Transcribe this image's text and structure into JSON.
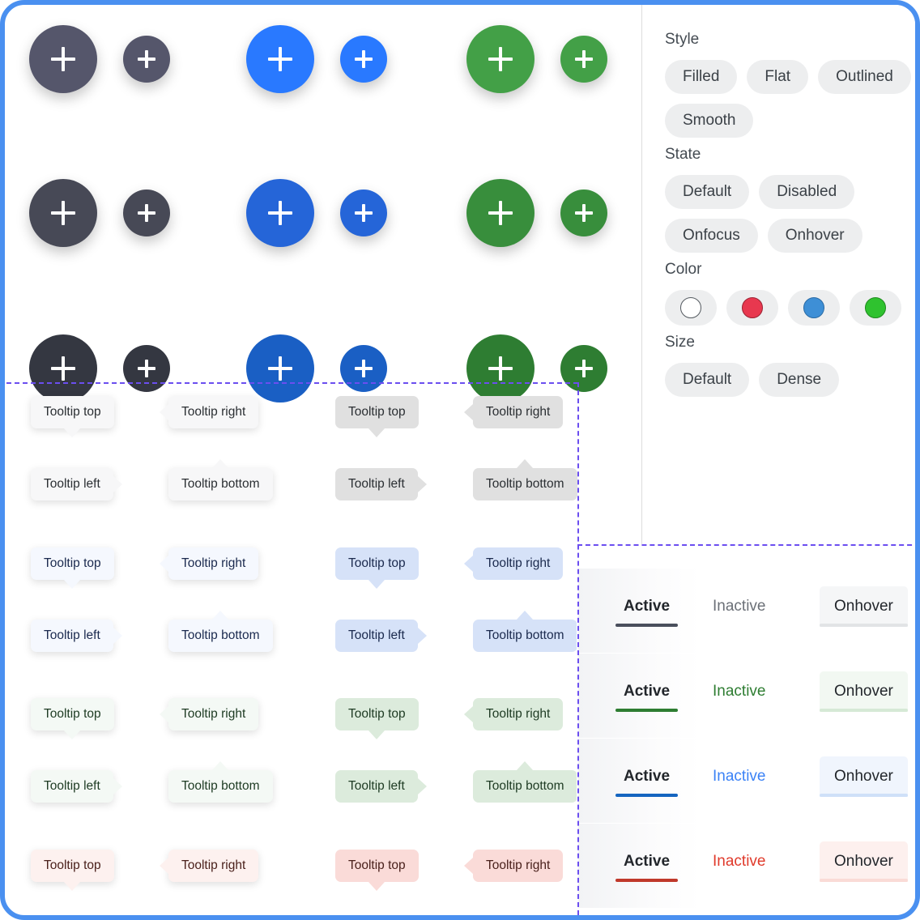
{
  "frame": {
    "border_color": "#4a90f0",
    "corner_radius": "30px",
    "guide_color": "#6b4ef0",
    "divider_color": "#dddddd"
  },
  "fab_section": {
    "name": "floating-action-buttons",
    "icon": "plus-icon",
    "rows": [
      {
        "style": "filled-shadow",
        "shadow": true,
        "groups": [
          {
            "color": "#55566b",
            "label": "dark"
          },
          {
            "color": "#2979ff",
            "label": "blue"
          },
          {
            "color": "#43a047",
            "label": "green"
          }
        ]
      },
      {
        "style": "filled-shadow",
        "shadow": true,
        "groups": [
          {
            "color": "#474956",
            "label": "dark"
          },
          {
            "color": "#2565d8",
            "label": "blue"
          },
          {
            "color": "#388e3c",
            "label": "green"
          }
        ]
      },
      {
        "style": "flat",
        "shadow": false,
        "groups": [
          {
            "color": "#343741",
            "label": "dark"
          },
          {
            "color": "#1a5fc4",
            "label": "blue"
          },
          {
            "color": "#2e7d32",
            "label": "green"
          }
        ]
      }
    ],
    "sizes": [
      "default",
      "dense"
    ]
  },
  "tooltips": {
    "name": "tooltip-gallery",
    "labels": {
      "top": "Tooltip top",
      "right": "Tooltip right",
      "left": "Tooltip left",
      "bottom": "Tooltip bottom"
    },
    "variants": [
      {
        "color_name": "neutral",
        "filled": {
          "bg": "#f7f7f8",
          "fg": "#2b2f33",
          "shadow": true
        },
        "flat": {
          "bg": "#e0e0e0",
          "fg": "#2b2f33",
          "shadow": false
        }
      },
      {
        "color_name": "blue",
        "filled": {
          "bg": "#f5f8fe",
          "fg": "#1b2a4e",
          "shadow": true
        },
        "flat": {
          "bg": "#d6e2f8",
          "fg": "#1b2a4e",
          "shadow": false
        }
      },
      {
        "color_name": "green",
        "filled": {
          "bg": "#f4f9f5",
          "fg": "#1e3b23",
          "shadow": true
        },
        "flat": {
          "bg": "#dcebdc",
          "fg": "#1e3b23",
          "shadow": false
        }
      },
      {
        "color_name": "red",
        "filled": {
          "bg": "#fdf1ef",
          "fg": "#4a211c",
          "shadow": true
        },
        "flat": {
          "bg": "#fadbd8",
          "fg": "#4a211c",
          "shadow": false
        }
      }
    ]
  },
  "sidebar": {
    "name": "properties-panel",
    "sections": [
      {
        "label": "Style",
        "key": "style",
        "options": [
          "Filled",
          "Flat",
          "Outlined",
          "Smooth"
        ]
      },
      {
        "label": "State",
        "key": "state",
        "options": [
          "Default",
          "Disabled",
          "Onfocus",
          "Onhover"
        ]
      },
      {
        "label": "Color",
        "key": "color",
        "swatches": [
          {
            "name": "none",
            "hex": "#ffffff",
            "border": "#555b61"
          },
          {
            "name": "red",
            "hex": "#e8384f",
            "border": "#9c2434"
          },
          {
            "name": "blue",
            "hex": "#3e8fd6",
            "border": "#2a6ba5"
          },
          {
            "name": "green",
            "hex": "#2fc22f",
            "border": "#1f8a1f"
          }
        ]
      },
      {
        "label": "Size",
        "key": "size",
        "options": [
          "Default",
          "Dense"
        ]
      }
    ]
  },
  "tabs_panel": {
    "name": "tabs-gallery",
    "labels": {
      "active": "Active",
      "inactive": "Inactive",
      "onhover": "Onhover"
    },
    "rows": [
      {
        "color_name": "neutral",
        "active_bar": "#4a4f5c",
        "active_fg": "#22262b",
        "inactive_fg": "#6b7077",
        "hover_bg": "#f5f6f7",
        "hover_bar": "#e2e4e6"
      },
      {
        "color_name": "green",
        "active_bar": "#2e7d32",
        "active_fg": "#22262b",
        "inactive_fg": "#2e7d32",
        "hover_bg": "#f2f8f2",
        "hover_bar": "#d6e9d6"
      },
      {
        "color_name": "blue",
        "active_bar": "#1565c0",
        "active_fg": "#22262b",
        "inactive_fg": "#3b82f6",
        "hover_bg": "#f0f5fd",
        "hover_bar": "#cfe0f8"
      },
      {
        "color_name": "red",
        "active_bar": "#c0392b",
        "active_fg": "#22262b",
        "inactive_fg": "#e03a2b",
        "hover_bg": "#fdf0ee",
        "hover_bar": "#fadbd6"
      }
    ]
  }
}
